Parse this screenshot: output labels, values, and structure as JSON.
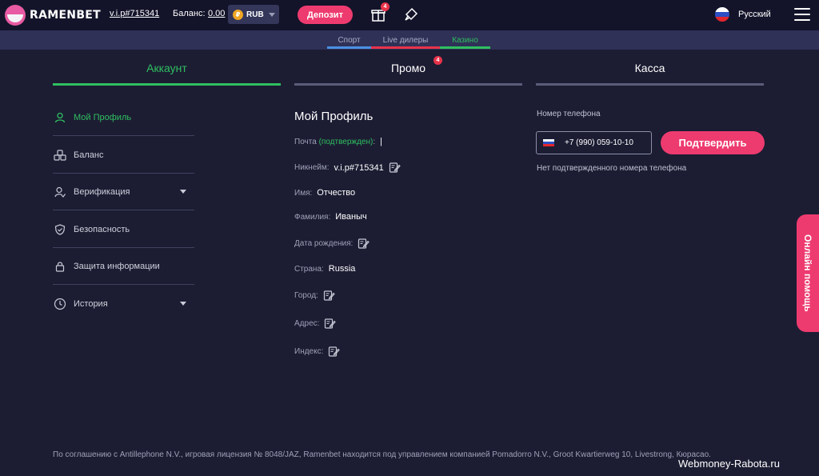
{
  "header": {
    "logo_text": "RAMENBET",
    "vip": "v.i.p#715341",
    "balance_label": "Баланс:",
    "balance_value": "0.00",
    "currency": "RUB",
    "currency_icon_letter": "₽",
    "deposit_label": "Депозит",
    "gift_badge": "4",
    "language": "Русский"
  },
  "subnav": {
    "items": [
      {
        "label": "Спорт",
        "color": "#4a90e2"
      },
      {
        "label": "Live дилеры",
        "color": "#e8334a"
      },
      {
        "label": "Казино",
        "color": "#2fbf5f"
      }
    ]
  },
  "tabs": [
    {
      "label": "Аккаунт"
    },
    {
      "label": "Промо",
      "badge": "4"
    },
    {
      "label": "Касса"
    }
  ],
  "sidebar": {
    "items": [
      {
        "label": "Мой Профиль",
        "icon": "user-icon"
      },
      {
        "label": "Баланс",
        "icon": "coins-icon"
      },
      {
        "label": "Верификация",
        "icon": "verify-icon"
      },
      {
        "label": "Безопасность",
        "icon": "shield-icon"
      },
      {
        "label": "Защита информации",
        "icon": "lock-icon"
      },
      {
        "label": "История",
        "icon": "history-icon"
      }
    ]
  },
  "profile": {
    "title": "Мой Профиль",
    "email_label": "Почта",
    "email_status": "(подтвержден)",
    "email_colon": ":",
    "email_value": "|",
    "nick_label": "Никнейм:",
    "nick_value": "v.i.p#715341",
    "name_label": "Имя:",
    "name_value": "Отчество",
    "surname_label": "Фамилия:",
    "surname_value": "Иваныч",
    "birth_label": "Дата рождения:",
    "country_label": "Страна:",
    "country_value": "Russia",
    "city_label": "Город:",
    "address_label": "Адрес:",
    "index_label": "Индекс:"
  },
  "kassa": {
    "phone_label": "Номер телефона",
    "phone_value": "+7 (990) 059-10-10",
    "confirm_label": "Подтвердить",
    "no_phone": "Нет подтвержденного номера телефона"
  },
  "help_label": "Онлайн помощь",
  "footer_text": "По соглашению с Antillephone N.V., игровая лицензия № 8048/JAZ, Ramenbet находится под управлением компанией Pomadorro N.V., Groot Kwartierweg 10, Livestrong, Кюрасао.",
  "watermark": "Webmoney-Rabota.ru",
  "colors": {
    "accent": "#ee3b6f",
    "green": "#2fbf5f",
    "bg": "#1c1d33"
  }
}
